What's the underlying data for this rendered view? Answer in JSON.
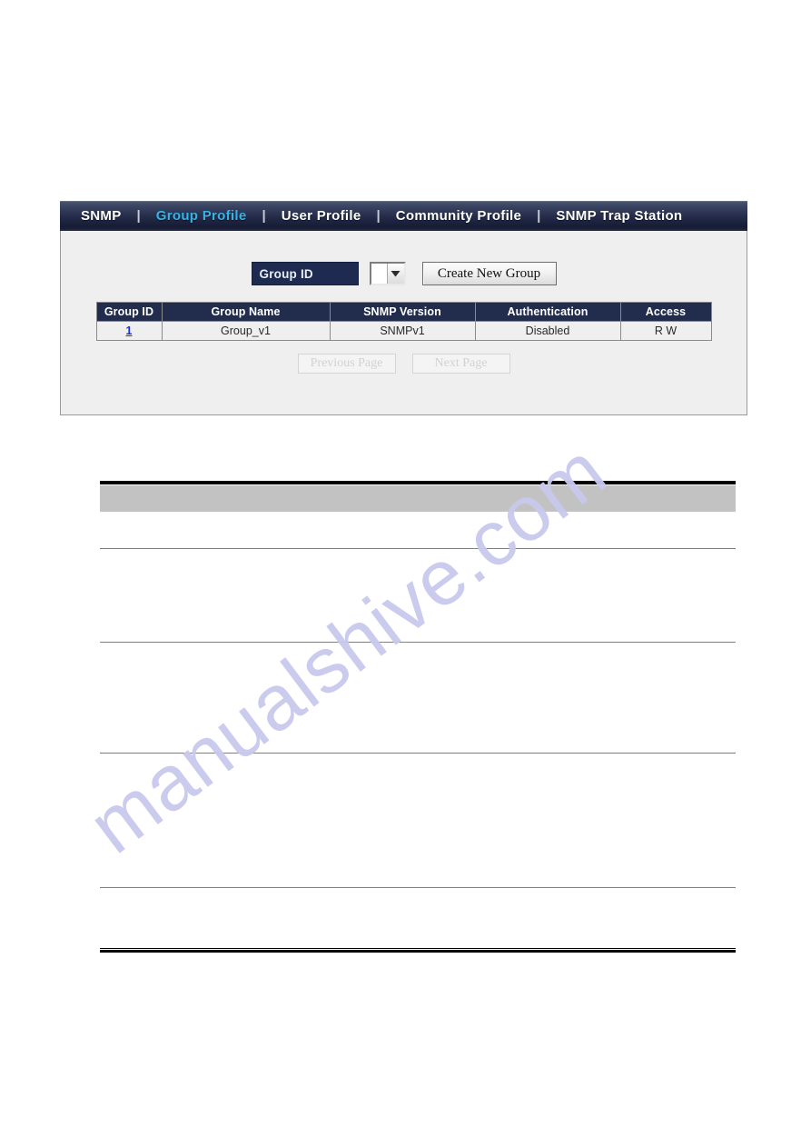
{
  "page": {
    "watermark_text": "manualshive.com",
    "watermark_color": "#c9c9ee",
    "background": "#ffffff"
  },
  "snmp_panel": {
    "tabs": [
      {
        "label": "SNMP",
        "active": false
      },
      {
        "label": "Group Profile",
        "active": true
      },
      {
        "label": "User Profile",
        "active": false
      },
      {
        "label": "Community Profile",
        "active": false
      },
      {
        "label": "SNMP Trap Station",
        "active": false
      }
    ],
    "tab_separator": "|",
    "active_tab_color": "#36b4e8",
    "tab_bar_color": "#1d2440",
    "controls": {
      "group_id_label": "Group ID",
      "group_id_value": "",
      "group_id_options": [],
      "create_button_label": "Create New Group"
    },
    "table": {
      "columns": [
        "Group ID",
        "Group Name",
        "SNMP Version",
        "Authentication",
        "Access"
      ],
      "rows": [
        {
          "group_id": "1",
          "group_name": "Group_v1",
          "snmp_version": "SNMPv1",
          "authentication": "Disabled",
          "access": "R W"
        }
      ],
      "header_color": "#222d4e",
      "link_color": "#1a2fd0"
    },
    "pagination": {
      "previous_label": "Previous Page",
      "next_label": "Next Page",
      "previous_enabled": false,
      "next_enabled": false
    }
  },
  "document_table": {
    "header_band_color": "#c2c2c2",
    "header_cells": [],
    "rows": [
      {
        "cells": []
      },
      {
        "cells": []
      },
      {
        "cells": []
      },
      {
        "cells": []
      },
      {
        "cells": []
      }
    ]
  }
}
